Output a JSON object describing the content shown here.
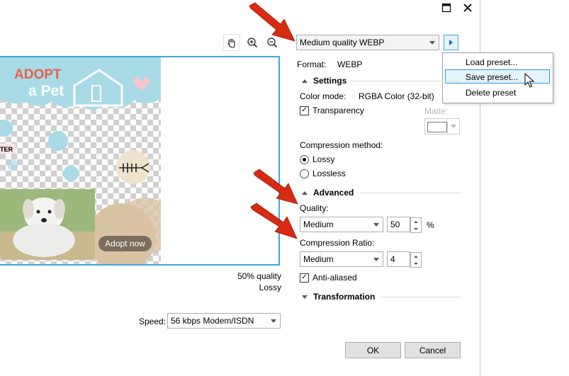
{
  "titlebar": {
    "maximize_icon": "maximize-icon",
    "close_icon": "close-icon"
  },
  "toolbar": {
    "pan_icon": "hand-icon",
    "zoom_in_icon": "zoom-in-icon",
    "zoom_out_icon": "zoom-out-icon"
  },
  "preview": {
    "poster": {
      "title_line1": "ADOPT",
      "title_line2": "a Pet",
      "center_label": "TER",
      "adopt_button": "Adopt now"
    },
    "quality_caption": "50% quality",
    "mode_caption": "Lossy"
  },
  "speed": {
    "label": "Speed:",
    "value": "56 kbps Modem/ISDN"
  },
  "preset": {
    "value": "Medium quality WEBP"
  },
  "preset_menu": {
    "items": [
      "Load preset...",
      "Save preset...",
      "Delete preset"
    ]
  },
  "format": {
    "label": "Format:",
    "value": "WEBP"
  },
  "settings": {
    "title": "Settings",
    "color_mode_label": "Color mode:",
    "color_mode_value": "RGBA Color (32-bit)",
    "transparency_label": "Transparency",
    "transparency_checked": true,
    "matte_label": "Matte:",
    "compression_method_label": "Compression method:",
    "lossy_label": "Lossy",
    "lossless_label": "Lossless",
    "selected_method": "Lossy"
  },
  "advanced": {
    "title": "Advanced",
    "quality_label": "Quality:",
    "quality_preset": "Medium",
    "quality_value": "50",
    "quality_unit": "%",
    "ratio_label": "Compression Ratio:",
    "ratio_preset": "Medium",
    "ratio_value": "4",
    "antialiased_label": "Anti-aliased",
    "antialiased_checked": true
  },
  "transformation": {
    "title": "Transformation"
  },
  "buttons": {
    "ok": "OK",
    "cancel": "Cancel"
  },
  "colors": {
    "annotation_arrow": "#d72a10",
    "selection_border": "#26a0da",
    "poster_blue": "#a8dbe6",
    "poster_beige": "#d9c3a5"
  }
}
